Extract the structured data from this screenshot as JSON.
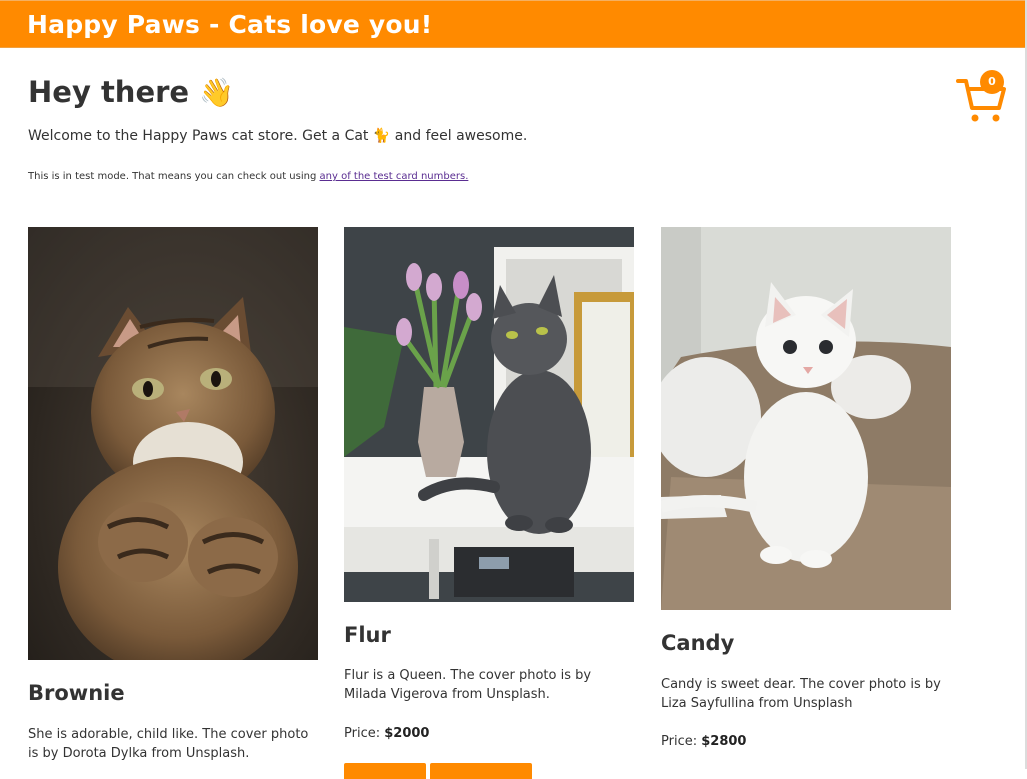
{
  "header": {
    "brand": "Happy Paws - Cats love you!"
  },
  "hero": {
    "title": "Hey there",
    "wave_emoji": "👋",
    "welcome_before": "Welcome to the Happy Paws cat store. Get a Cat",
    "cat_emoji": "🐈",
    "welcome_after": "and feel awesome.",
    "test_text": "This is in test mode. That means you can check out using",
    "test_link": "any of the test card numbers."
  },
  "cart": {
    "count": "0",
    "icon": "shopping-cart-icon"
  },
  "products": [
    {
      "name": "Brownie",
      "description": "She is adorable, child like. The cover photo is by Dorota Dylka from Unsplash.",
      "image": "tabby-cat-photo"
    },
    {
      "name": "Flur",
      "description": "Flur is a Queen. The cover photo is by Milada Vigerova from Unsplash.",
      "price_label": "Price:",
      "price": "$2000",
      "image": "grey-cat-photo"
    },
    {
      "name": "Candy",
      "description": "Candy is sweet dear. The cover photo is by Liza Sayfullina from Unsplash",
      "price_label": "Price:",
      "price": "$2800",
      "image": "white-cat-photo"
    }
  ],
  "colors": {
    "accent": "#ff8a00",
    "text": "#333333",
    "link": "#5a2d91"
  }
}
